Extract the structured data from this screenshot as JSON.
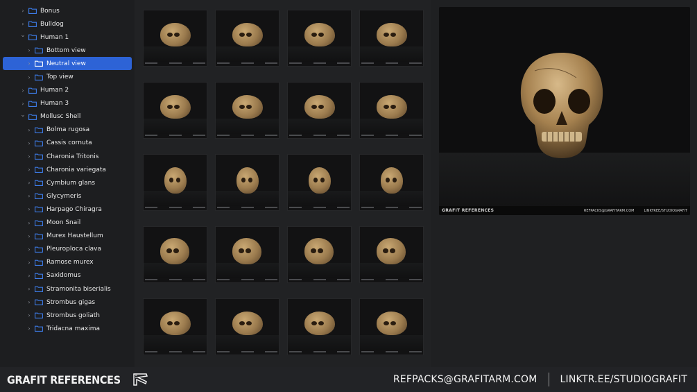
{
  "colors": {
    "selection": "#2d63d6",
    "folder": "#3d7be6",
    "background": "#1b1c1e"
  },
  "tree": [
    {
      "label": "Bonus",
      "depth": 1,
      "expanded": false,
      "selected": false
    },
    {
      "label": "Bulldog",
      "depth": 1,
      "expanded": false,
      "selected": false
    },
    {
      "label": "Human 1",
      "depth": 1,
      "expanded": true,
      "selected": false
    },
    {
      "label": "Bottom view",
      "depth": 2,
      "expanded": false,
      "selected": false
    },
    {
      "label": "Neutral view",
      "depth": 2,
      "expanded": false,
      "selected": true
    },
    {
      "label": "Top view",
      "depth": 2,
      "expanded": false,
      "selected": false
    },
    {
      "label": "Human 2",
      "depth": 1,
      "expanded": false,
      "selected": false
    },
    {
      "label": "Human 3",
      "depth": 1,
      "expanded": false,
      "selected": false
    },
    {
      "label": "Mollusc Shell",
      "depth": 1,
      "expanded": true,
      "selected": false
    },
    {
      "label": "Bolma rugosa",
      "depth": 2,
      "expanded": false,
      "selected": false
    },
    {
      "label": "Cassis cornuta",
      "depth": 2,
      "expanded": false,
      "selected": false
    },
    {
      "label": "Charonia Tritonis",
      "depth": 2,
      "expanded": false,
      "selected": false
    },
    {
      "label": "Charonia variegata",
      "depth": 2,
      "expanded": false,
      "selected": false
    },
    {
      "label": "Cymbium glans",
      "depth": 2,
      "expanded": false,
      "selected": false
    },
    {
      "label": "Glycymeris",
      "depth": 2,
      "expanded": false,
      "selected": false
    },
    {
      "label": "Harpago Chiragra",
      "depth": 2,
      "expanded": false,
      "selected": false
    },
    {
      "label": "Moon Snail",
      "depth": 2,
      "expanded": false,
      "selected": false
    },
    {
      "label": "Murex Haustellum",
      "depth": 2,
      "expanded": false,
      "selected": false
    },
    {
      "label": "Pleuroploca clava",
      "depth": 2,
      "expanded": false,
      "selected": false
    },
    {
      "label": "Ramose murex",
      "depth": 2,
      "expanded": false,
      "selected": false
    },
    {
      "label": "Saxidomus",
      "depth": 2,
      "expanded": false,
      "selected": false
    },
    {
      "label": "Stramonita biserialis",
      "depth": 2,
      "expanded": false,
      "selected": false
    },
    {
      "label": "Strombus gigas",
      "depth": 2,
      "expanded": false,
      "selected": false
    },
    {
      "label": "Strombus goliath",
      "depth": 2,
      "expanded": false,
      "selected": false
    },
    {
      "label": "Tridacna maxima",
      "depth": 2,
      "expanded": false,
      "selected": false
    }
  ],
  "thumbnail_count": 20,
  "preview": {
    "brand": "GRAFIT REFERENCES",
    "email": "REFPACKS@GRAFITARM.COM",
    "link": "LINKTREE/STUDIOGRAFIT"
  },
  "footer": {
    "brand": "GRAFIT REFERENCES",
    "email": "REFPACKS@GRAFITARM.COM",
    "link": "LINKTR.EE/STUDIOGRAFIT"
  }
}
